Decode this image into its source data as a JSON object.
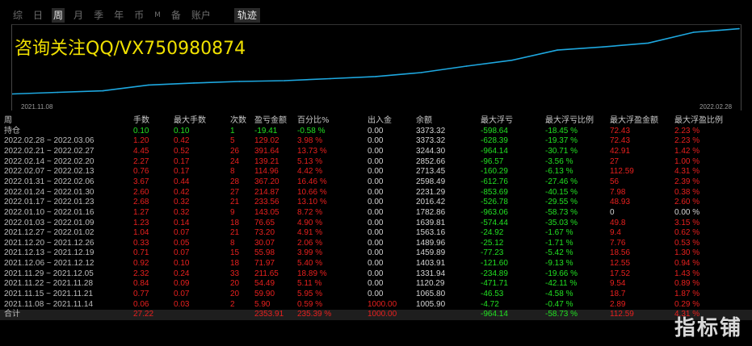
{
  "tabs": [
    "综",
    "日",
    "周",
    "月",
    "季",
    "年",
    "币",
    "M",
    "备",
    "账户"
  ],
  "active_tab": "周",
  "trajectory_tab": "轨迹",
  "watermark": "咨询关注QQ/VX750980874",
  "chart_data": {
    "type": "line",
    "x_start_label": "2021.11.08",
    "x_end_label": "2022.02.28",
    "line_color": "#1ea8e0",
    "x": [
      "2021.11.08",
      "2021.11.15",
      "2021.11.22",
      "2021.11.29",
      "2021.12.06",
      "2021.12.13",
      "2021.12.20",
      "2021.12.27",
      "2022.01.03",
      "2022.01.10",
      "2022.01.17",
      "2022.01.24",
      "2022.01.31",
      "2022.02.07",
      "2022.02.14",
      "2022.02.21",
      "2022.02.28"
    ],
    "values": [
      1005.9,
      1065.8,
      1120.29,
      1331.94,
      1403.91,
      1459.89,
      1489.96,
      1563.16,
      1639.81,
      1782.86,
      2016.42,
      2231.29,
      2598.49,
      2713.45,
      2852.66,
      3244.3,
      3373.32
    ]
  },
  "table": {
    "headers": [
      "周",
      "手数",
      "最大手数",
      "次数",
      "盈亏金额",
      "百分比%",
      "出入金",
      "余额",
      "最大浮亏",
      "最大浮亏比例",
      "最大浮盈金额",
      "最大浮盈比例"
    ],
    "rows": [
      {
        "cells": [
          "持仓",
          "0.10",
          "0.10",
          "1",
          "-19.41",
          "-0.58 %",
          "0.00",
          "3373.32",
          "-598.64",
          "-18.45 %",
          "72.43",
          "2.23 %"
        ],
        "colors": [
          "white",
          "green",
          "green",
          "green",
          "green",
          "green",
          "white",
          "white",
          "green",
          "green",
          "red",
          "red"
        ]
      },
      {
        "cells": [
          "2022.02.28 ~ 2022.03.06",
          "1.20",
          "0.42",
          "5",
          "129.02",
          "3.98 %",
          "0.00",
          "3373.32",
          "-628.39",
          "-19.37 %",
          "72.43",
          "2.23 %"
        ],
        "colors": [
          "white",
          "red",
          "red",
          "red",
          "red",
          "red",
          "white",
          "white",
          "green",
          "green",
          "red",
          "red"
        ]
      },
      {
        "cells": [
          "2022.02.21 ~ 2022.02.27",
          "4.45",
          "0.52",
          "26",
          "391.64",
          "13.73 %",
          "0.00",
          "3244.30",
          "-964.14",
          "-30.71 %",
          "42.91",
          "1.42 %"
        ],
        "colors": [
          "white",
          "red",
          "red",
          "red",
          "red",
          "red",
          "white",
          "white",
          "green",
          "green",
          "red",
          "red"
        ]
      },
      {
        "cells": [
          "2022.02.14 ~ 2022.02.20",
          "2.27",
          "0.17",
          "24",
          "139.21",
          "5.13 %",
          "0.00",
          "2852.66",
          "-96.57",
          "-3.56 %",
          "27",
          "1.00 %"
        ],
        "colors": [
          "white",
          "red",
          "red",
          "red",
          "red",
          "red",
          "white",
          "white",
          "green",
          "green",
          "red",
          "red"
        ]
      },
      {
        "cells": [
          "2022.02.07 ~ 2022.02.13",
          "0.76",
          "0.17",
          "8",
          "114.96",
          "4.42 %",
          "0.00",
          "2713.45",
          "-160.29",
          "-6.13 %",
          "112.59",
          "4.31 %"
        ],
        "colors": [
          "white",
          "red",
          "red",
          "red",
          "red",
          "red",
          "white",
          "white",
          "green",
          "green",
          "red",
          "red"
        ]
      },
      {
        "cells": [
          "2022.01.31 ~ 2022.02.06",
          "3.67",
          "0.44",
          "28",
          "367.20",
          "16.46 %",
          "0.00",
          "2598.49",
          "-612.76",
          "-27.46 %",
          "56",
          "2.39 %"
        ],
        "colors": [
          "white",
          "red",
          "red",
          "red",
          "red",
          "red",
          "white",
          "white",
          "green",
          "green",
          "red",
          "red"
        ]
      },
      {
        "cells": [
          "2022.01.24 ~ 2022.01.30",
          "2.60",
          "0.42",
          "27",
          "214.87",
          "10.66 %",
          "0.00",
          "2231.29",
          "-853.69",
          "-40.15 %",
          "7.98",
          "0.38 %"
        ],
        "colors": [
          "white",
          "red",
          "red",
          "red",
          "red",
          "red",
          "white",
          "white",
          "green",
          "green",
          "red",
          "red"
        ]
      },
      {
        "cells": [
          "2022.01.17 ~ 2022.01.23",
          "2.68",
          "0.32",
          "21",
          "233.56",
          "13.10 %",
          "0.00",
          "2016.42",
          "-526.78",
          "-29.55 %",
          "48.93",
          "2.60 %"
        ],
        "colors": [
          "white",
          "red",
          "red",
          "red",
          "red",
          "red",
          "white",
          "white",
          "green",
          "green",
          "red",
          "red"
        ]
      },
      {
        "cells": [
          "2022.01.10 ~ 2022.01.16",
          "1.27",
          "0.32",
          "9",
          "143.05",
          "8.72 %",
          "0.00",
          "1782.86",
          "-963.06",
          "-58.73 %",
          "0",
          "0.00 %"
        ],
        "colors": [
          "white",
          "red",
          "red",
          "red",
          "red",
          "red",
          "white",
          "white",
          "green",
          "green",
          "white",
          "white"
        ]
      },
      {
        "cells": [
          "2022.01.03 ~ 2022.01.09",
          "1.23",
          "0.14",
          "18",
          "76.65",
          "4.90 %",
          "0.00",
          "1639.81",
          "-574.44",
          "-35.03 %",
          "49.8",
          "3.15 %"
        ],
        "colors": [
          "white",
          "red",
          "red",
          "red",
          "red",
          "red",
          "white",
          "white",
          "green",
          "green",
          "red",
          "red"
        ]
      },
      {
        "cells": [
          "2021.12.27 ~ 2022.01.02",
          "1.04",
          "0.07",
          "21",
          "73.20",
          "4.91 %",
          "0.00",
          "1563.16",
          "-24.92",
          "-1.67 %",
          "9.4",
          "0.62 %"
        ],
        "colors": [
          "white",
          "red",
          "red",
          "red",
          "red",
          "red",
          "white",
          "white",
          "green",
          "green",
          "red",
          "red"
        ]
      },
      {
        "cells": [
          "2021.12.20 ~ 2021.12.26",
          "0.33",
          "0.05",
          "8",
          "30.07",
          "2.06 %",
          "0.00",
          "1489.96",
          "-25.12",
          "-1.71 %",
          "7.76",
          "0.53 %"
        ],
        "colors": [
          "white",
          "red",
          "red",
          "red",
          "red",
          "red",
          "white",
          "white",
          "green",
          "green",
          "red",
          "red"
        ]
      },
      {
        "cells": [
          "2021.12.13 ~ 2021.12.19",
          "0.71",
          "0.07",
          "15",
          "55.98",
          "3.99 %",
          "0.00",
          "1459.89",
          "-77.23",
          "-5.42 %",
          "18.56",
          "1.30 %"
        ],
        "colors": [
          "white",
          "red",
          "red",
          "red",
          "red",
          "red",
          "white",
          "white",
          "green",
          "green",
          "red",
          "red"
        ]
      },
      {
        "cells": [
          "2021.12.06 ~ 2021.12.12",
          "0.92",
          "0.10",
          "18",
          "71.97",
          "5.40 %",
          "0.00",
          "1403.91",
          "-121.60",
          "-9.13 %",
          "12.55",
          "0.94 %"
        ],
        "colors": [
          "white",
          "red",
          "red",
          "red",
          "red",
          "red",
          "white",
          "white",
          "green",
          "green",
          "red",
          "red"
        ]
      },
      {
        "cells": [
          "2021.11.29 ~ 2021.12.05",
          "2.32",
          "0.24",
          "33",
          "211.65",
          "18.89 %",
          "0.00",
          "1331.94",
          "-234.89",
          "-19.66 %",
          "17.52",
          "1.43 %"
        ],
        "colors": [
          "white",
          "red",
          "red",
          "red",
          "red",
          "red",
          "white",
          "white",
          "green",
          "green",
          "red",
          "red"
        ]
      },
      {
        "cells": [
          "2021.11.22 ~ 2021.11.28",
          "0.84",
          "0.09",
          "20",
          "54.49",
          "5.11 %",
          "0.00",
          "1120.29",
          "-471.71",
          "-42.11 %",
          "9.54",
          "0.89 %"
        ],
        "colors": [
          "white",
          "red",
          "red",
          "red",
          "red",
          "red",
          "white",
          "white",
          "green",
          "green",
          "red",
          "red"
        ]
      },
      {
        "cells": [
          "2021.11.15 ~ 2021.11.21",
          "0.77",
          "0.07",
          "20",
          "59.90",
          "5.95 %",
          "0.00",
          "1065.80",
          "-46.53",
          "-4.58 %",
          "18.7",
          "1.87 %"
        ],
        "colors": [
          "white",
          "red",
          "red",
          "red",
          "red",
          "red",
          "white",
          "white",
          "green",
          "green",
          "red",
          "red"
        ]
      },
      {
        "cells": [
          "2021.11.08 ~ 2021.11.14",
          "0.06",
          "0.03",
          "2",
          "5.90",
          "0.59 %",
          "1000.00",
          "1005.90",
          "-4.72",
          "-0.47 %",
          "2.89",
          "0.29 %"
        ],
        "colors": [
          "white",
          "red",
          "red",
          "red",
          "red",
          "red",
          "red",
          "white",
          "green",
          "green",
          "red",
          "red"
        ]
      }
    ],
    "total": {
      "cells": [
        "合计",
        "27.22",
        "",
        "",
        "2353.91",
        "235.39 %",
        "1000.00",
        "",
        "-964.14",
        "-58.73 %",
        "112.59",
        "4.31 %"
      ],
      "colors": [
        "white",
        "red",
        "red",
        "red",
        "red",
        "red",
        "red",
        "white",
        "green",
        "green",
        "red",
        "red"
      ]
    }
  },
  "brand_badge": "指标铺"
}
